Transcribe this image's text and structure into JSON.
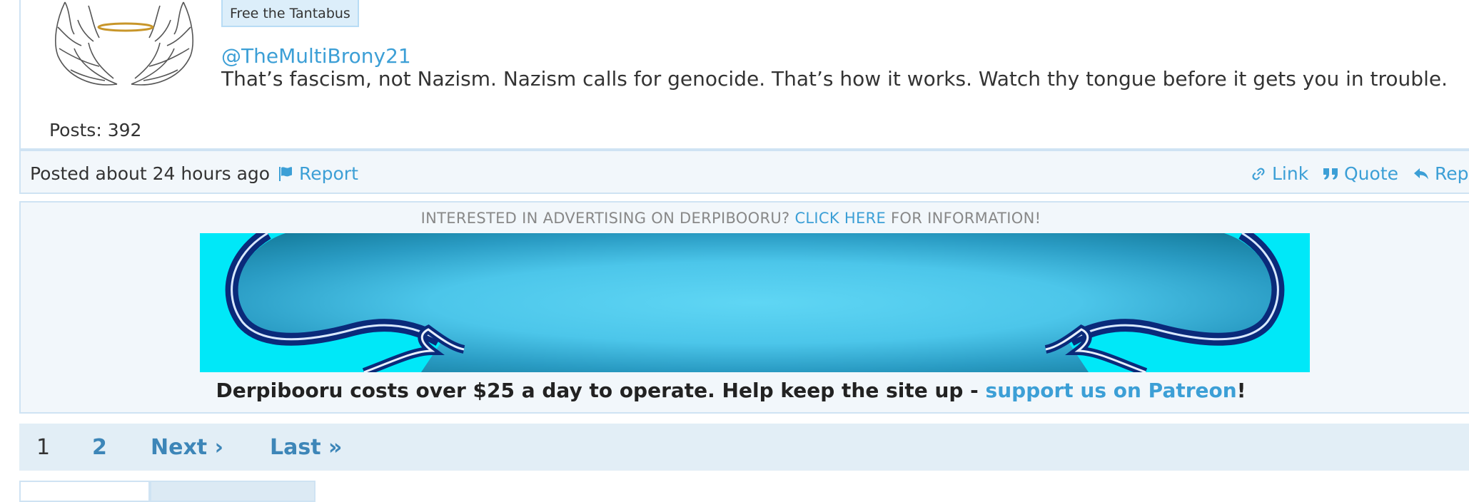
{
  "post": {
    "badge": "Free the Tantabus",
    "mention": "@TheMultiBrony21",
    "body": "That’s fascism, not Nazism. Nazism calls for genocide. That’s how it works. Watch thy tongue before it gets you in trouble.",
    "posts_count": "Posts: 392",
    "posted": "Posted about 24 hours ago",
    "actions": {
      "report": "Report",
      "link": "Link",
      "quote": "Quote",
      "reply": "Reply"
    }
  },
  "ad": {
    "prefix": "INTERESTED IN ADVERTISING ON DERPIBOORU? ",
    "click_here": "CLICK HERE",
    "suffix": " FOR INFORMATION!",
    "donate_prefix": "Derpibooru costs over $25 a day to operate. Help keep the site up - ",
    "donate_link": "support us on Patreon",
    "donate_suffix": "!"
  },
  "pagination": {
    "current": "1",
    "page2": "2",
    "next": "Next ›",
    "last": "Last »"
  },
  "icons": {
    "avatar": "angel-wings-halo-icon",
    "report": "flag-icon",
    "link": "chain-link-icon",
    "quote": "quote-icon",
    "reply": "reply-arrow-icon"
  },
  "colors": {
    "link": "#3c9fd6",
    "border": "#cfe3f3",
    "footer_bg": "#f2f7fb",
    "pagination_bg": "#e2eef6"
  }
}
